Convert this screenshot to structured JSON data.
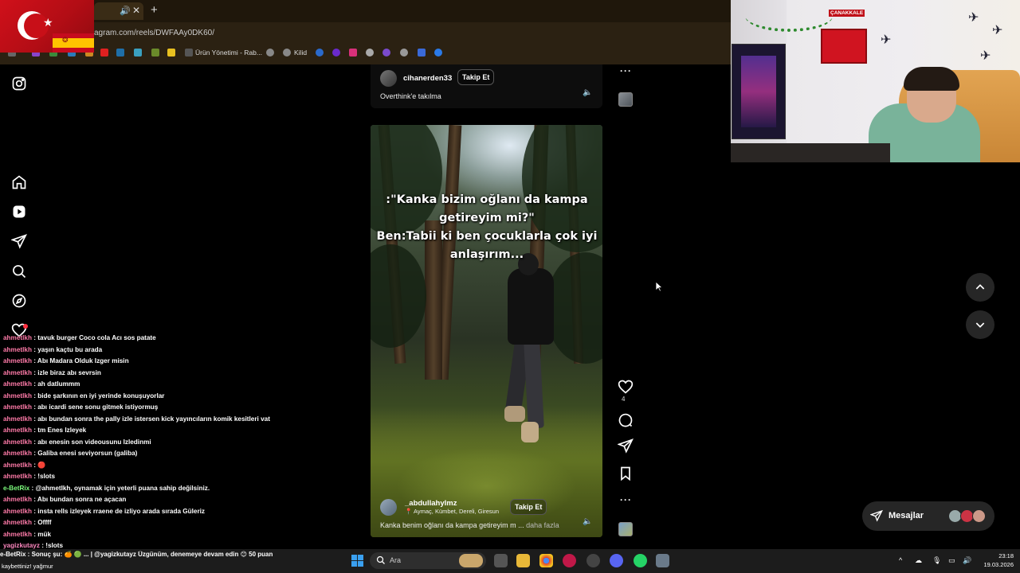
{
  "browser": {
    "url": "agram.com/reels/DWFAAy0DK60/",
    "new_tab": "+",
    "tab_close": "✕",
    "bookmarks": [
      "Ürün Yönetimi - Rab...",
      "Kilid"
    ]
  },
  "reels": {
    "top": {
      "username": "cihanerden33",
      "follow_label": "Takip Et",
      "caption": "Overthink'e takılma"
    },
    "current": {
      "overlay_lines": [
        ":\"Kanka bizim oğlanı da kampa",
        "getireyim mi?\"",
        "Ben:Tabii ki ben çocuklarla çok iyi",
        "anlaşırım..."
      ],
      "username": "_abdullahylmz",
      "follow_label": "Takip Et",
      "location": "Aymaç, Kümbet, Dereli, Giresun",
      "caption": "Kanka benim oğlanı da kampa getireyim m ...",
      "caption_more": "daha fazla",
      "like_count": "4"
    }
  },
  "messages": {
    "label": "Mesajlar"
  },
  "webcam": {
    "poster_text": "ÇANAKKALE"
  },
  "chat": {
    "lines": [
      {
        "user": "ahmetlkh",
        "text": ": tavuk burger Coco cola Acı sos patate"
      },
      {
        "user": "ahmetlkh",
        "text": ": yaşın kaçtu bu arada"
      },
      {
        "user": "ahmetlkh",
        "text": ": Abı Madara Olduk Izger misin"
      },
      {
        "user": "ahmetlkh",
        "text": ": izle biraz abı sevrsin"
      },
      {
        "user": "ahmetlkh",
        "text": ": ah datlummm"
      },
      {
        "user": "ahmetlkh",
        "text": ": bide şarkının en iyi yerinde konuşuyorlar"
      },
      {
        "user": "ahmetlkh",
        "text": ": abı icardi sene sonu gitmek istiyormuş"
      },
      {
        "user": "ahmetlkh",
        "text": ": abı bundan sonra the pally izle istersen kick yayıncıların komik kesitleri vat"
      },
      {
        "user": "ahmetlkh",
        "text": ": tm Enes Izleyek"
      },
      {
        "user": "ahmetlkh",
        "text": ": abı enesin son videousunu Izledinmi"
      },
      {
        "user": "ahmetlkh",
        "text": ": Galiba enesi seviyorsun (galiba)"
      },
      {
        "user": "ahmetlkh",
        "text": ": 🔴"
      },
      {
        "user": "ahmetlkh",
        "text": ": !slots"
      },
      {
        "user": "e-BetRix",
        "text": ": @ahmetlkh, oynamak için yeterli puana sahip değilsiniz."
      },
      {
        "user": "ahmetlkh",
        "text": ": Abı bundan sonra ne açacan"
      },
      {
        "user": "ahmetlkh",
        "text": ": insta rells izleyek rraene de izliyo arada sırada Güleriz"
      },
      {
        "user": "ahmetlkh",
        "text": ": Offff"
      },
      {
        "user": "ahmetlkh",
        "text": ": mük"
      },
      {
        "user": "yagizkutayz",
        "text": ": !slots"
      }
    ],
    "ticker": "e-BetRix : Sonuç şu: 🍊 🟢 ... | @yagizkutayz Üzgünüm, denemeye devam edin 😊 50 puan",
    "ticker2": "kaybettiniz!  yağmur"
  },
  "taskbar": {
    "search_placeholder": "Ara",
    "time": "23:18",
    "date": "19.03.2026"
  },
  "icons": {
    "rail": [
      "instagram-icon",
      "home-icon",
      "reels-icon",
      "direct-icon",
      "search-icon",
      "explore-icon",
      "heart-icon"
    ],
    "actions": [
      "like-icon",
      "comment-icon",
      "share-icon",
      "save-icon",
      "more-icon"
    ]
  },
  "colors": {
    "background": "#000000",
    "button_bg": "#262626",
    "chat_user": "#ff7aa8",
    "notification": "#ff3040"
  }
}
